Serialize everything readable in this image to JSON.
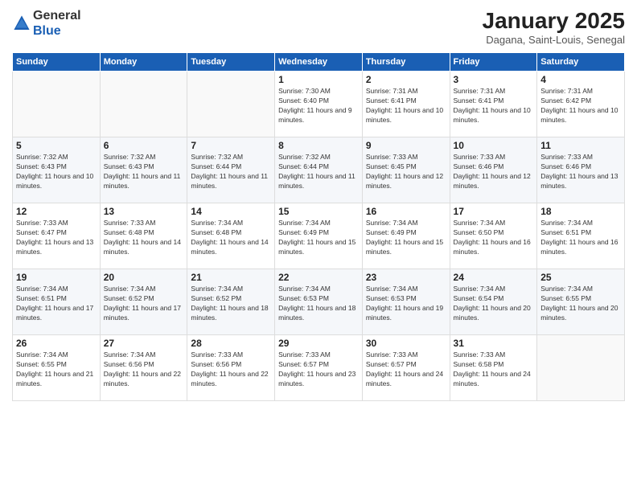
{
  "logo": {
    "general": "General",
    "blue": "Blue"
  },
  "header": {
    "month": "January 2025",
    "location": "Dagana, Saint-Louis, Senegal"
  },
  "weekdays": [
    "Sunday",
    "Monday",
    "Tuesday",
    "Wednesday",
    "Thursday",
    "Friday",
    "Saturday"
  ],
  "weeks": [
    [
      {
        "day": "",
        "info": ""
      },
      {
        "day": "",
        "info": ""
      },
      {
        "day": "",
        "info": ""
      },
      {
        "day": "1",
        "info": "Sunrise: 7:30 AM\nSunset: 6:40 PM\nDaylight: 11 hours and 9 minutes."
      },
      {
        "day": "2",
        "info": "Sunrise: 7:31 AM\nSunset: 6:41 PM\nDaylight: 11 hours and 10 minutes."
      },
      {
        "day": "3",
        "info": "Sunrise: 7:31 AM\nSunset: 6:41 PM\nDaylight: 11 hours and 10 minutes."
      },
      {
        "day": "4",
        "info": "Sunrise: 7:31 AM\nSunset: 6:42 PM\nDaylight: 11 hours and 10 minutes."
      }
    ],
    [
      {
        "day": "5",
        "info": "Sunrise: 7:32 AM\nSunset: 6:43 PM\nDaylight: 11 hours and 10 minutes."
      },
      {
        "day": "6",
        "info": "Sunrise: 7:32 AM\nSunset: 6:43 PM\nDaylight: 11 hours and 11 minutes."
      },
      {
        "day": "7",
        "info": "Sunrise: 7:32 AM\nSunset: 6:44 PM\nDaylight: 11 hours and 11 minutes."
      },
      {
        "day": "8",
        "info": "Sunrise: 7:32 AM\nSunset: 6:44 PM\nDaylight: 11 hours and 11 minutes."
      },
      {
        "day": "9",
        "info": "Sunrise: 7:33 AM\nSunset: 6:45 PM\nDaylight: 11 hours and 12 minutes."
      },
      {
        "day": "10",
        "info": "Sunrise: 7:33 AM\nSunset: 6:46 PM\nDaylight: 11 hours and 12 minutes."
      },
      {
        "day": "11",
        "info": "Sunrise: 7:33 AM\nSunset: 6:46 PM\nDaylight: 11 hours and 13 minutes."
      }
    ],
    [
      {
        "day": "12",
        "info": "Sunrise: 7:33 AM\nSunset: 6:47 PM\nDaylight: 11 hours and 13 minutes."
      },
      {
        "day": "13",
        "info": "Sunrise: 7:33 AM\nSunset: 6:48 PM\nDaylight: 11 hours and 14 minutes."
      },
      {
        "day": "14",
        "info": "Sunrise: 7:34 AM\nSunset: 6:48 PM\nDaylight: 11 hours and 14 minutes."
      },
      {
        "day": "15",
        "info": "Sunrise: 7:34 AM\nSunset: 6:49 PM\nDaylight: 11 hours and 15 minutes."
      },
      {
        "day": "16",
        "info": "Sunrise: 7:34 AM\nSunset: 6:49 PM\nDaylight: 11 hours and 15 minutes."
      },
      {
        "day": "17",
        "info": "Sunrise: 7:34 AM\nSunset: 6:50 PM\nDaylight: 11 hours and 16 minutes."
      },
      {
        "day": "18",
        "info": "Sunrise: 7:34 AM\nSunset: 6:51 PM\nDaylight: 11 hours and 16 minutes."
      }
    ],
    [
      {
        "day": "19",
        "info": "Sunrise: 7:34 AM\nSunset: 6:51 PM\nDaylight: 11 hours and 17 minutes."
      },
      {
        "day": "20",
        "info": "Sunrise: 7:34 AM\nSunset: 6:52 PM\nDaylight: 11 hours and 17 minutes."
      },
      {
        "day": "21",
        "info": "Sunrise: 7:34 AM\nSunset: 6:52 PM\nDaylight: 11 hours and 18 minutes."
      },
      {
        "day": "22",
        "info": "Sunrise: 7:34 AM\nSunset: 6:53 PM\nDaylight: 11 hours and 18 minutes."
      },
      {
        "day": "23",
        "info": "Sunrise: 7:34 AM\nSunset: 6:53 PM\nDaylight: 11 hours and 19 minutes."
      },
      {
        "day": "24",
        "info": "Sunrise: 7:34 AM\nSunset: 6:54 PM\nDaylight: 11 hours and 20 minutes."
      },
      {
        "day": "25",
        "info": "Sunrise: 7:34 AM\nSunset: 6:55 PM\nDaylight: 11 hours and 20 minutes."
      }
    ],
    [
      {
        "day": "26",
        "info": "Sunrise: 7:34 AM\nSunset: 6:55 PM\nDaylight: 11 hours and 21 minutes."
      },
      {
        "day": "27",
        "info": "Sunrise: 7:34 AM\nSunset: 6:56 PM\nDaylight: 11 hours and 22 minutes."
      },
      {
        "day": "28",
        "info": "Sunrise: 7:33 AM\nSunset: 6:56 PM\nDaylight: 11 hours and 22 minutes."
      },
      {
        "day": "29",
        "info": "Sunrise: 7:33 AM\nSunset: 6:57 PM\nDaylight: 11 hours and 23 minutes."
      },
      {
        "day": "30",
        "info": "Sunrise: 7:33 AM\nSunset: 6:57 PM\nDaylight: 11 hours and 24 minutes."
      },
      {
        "day": "31",
        "info": "Sunrise: 7:33 AM\nSunset: 6:58 PM\nDaylight: 11 hours and 24 minutes."
      },
      {
        "day": "",
        "info": ""
      }
    ]
  ]
}
